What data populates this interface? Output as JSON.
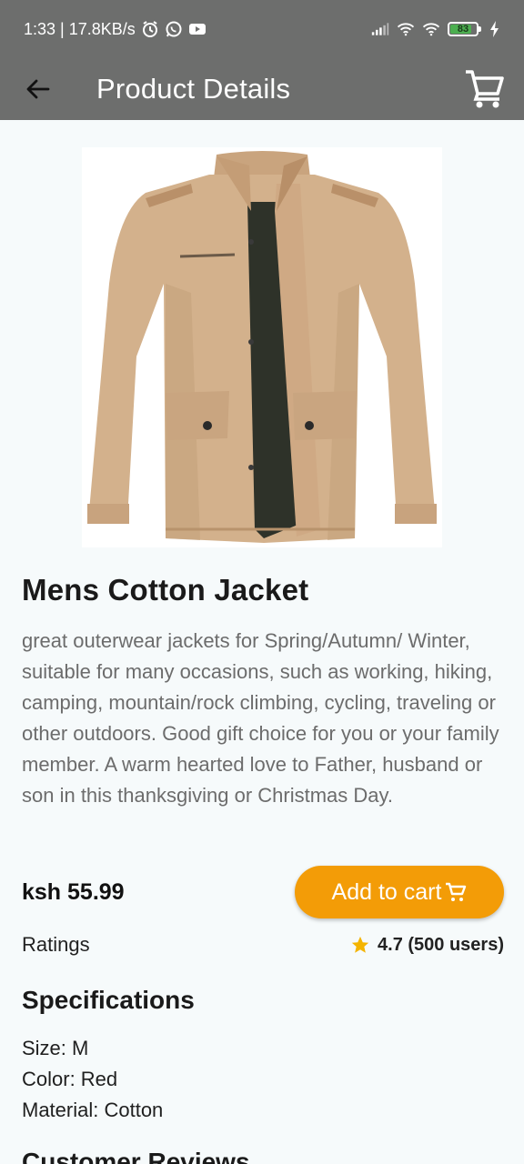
{
  "status_bar": {
    "left_text": "1:33 | 17.8KB/s",
    "battery_level": "83",
    "icons": [
      "alarm-icon",
      "whatsapp-icon",
      "youtube-icon",
      "signal-icon",
      "wifi-icon",
      "wifi-icon",
      "battery-icon",
      "charging-icon"
    ]
  },
  "app_bar": {
    "title": "Product Details",
    "back_icon": "arrow-left-icon",
    "cart_icon": "shopping-cart-icon"
  },
  "product": {
    "name": "Mens Cotton Jacket",
    "description": "great outerwear jackets for Spring/Autumn/ Winter, suitable for many occasions, such as working, hiking, camping, mountain/rock climbing, cycling, traveling or other outdoors. Good gift choice for you or your family member. A warm hearted love to Father, husband or son in this thanksgiving or Christmas Day.",
    "price": "ksh 55.99",
    "add_to_cart_label": "Add to cart",
    "ratings_label": "Ratings",
    "rating_value": "4.7 (500 users)"
  },
  "specifications": {
    "title": "Specifications",
    "items": [
      "Size: M",
      "Color: Red",
      "Material: Cotton"
    ]
  },
  "reviews": {
    "title": "Customer Reviews"
  },
  "colors": {
    "app_bar": "#6d6e6d",
    "accent": "#f39c07",
    "background": "#f6fafb",
    "star": "#f4b400"
  }
}
